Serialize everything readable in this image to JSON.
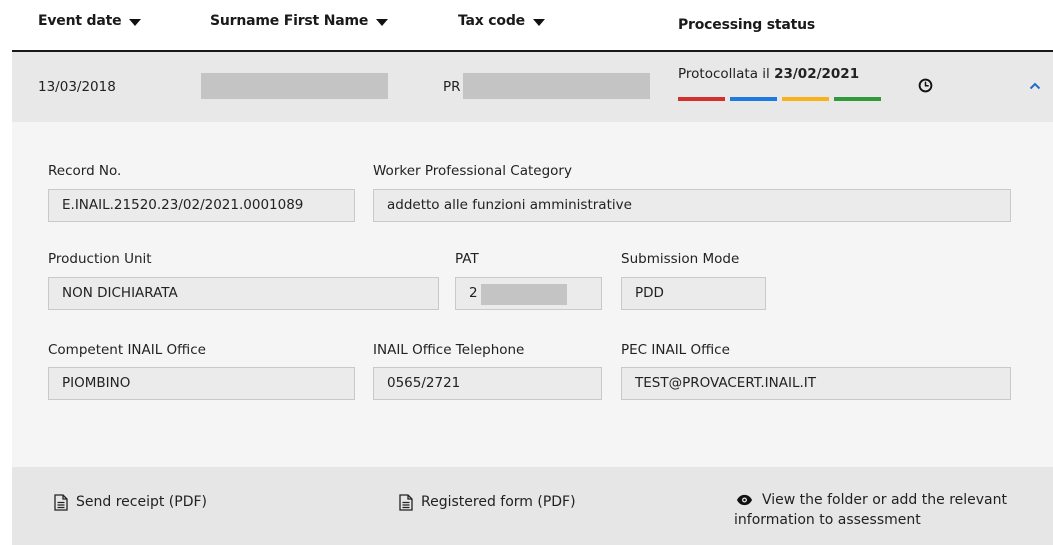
{
  "header": {
    "event_date": "Event date",
    "name": "Surname First Name",
    "tax_code": "Tax code",
    "status": "Processing status"
  },
  "row": {
    "event_date": "13/03/2018",
    "tax_code_prefix": "PR",
    "status_prefix": "Protocollata il ",
    "status_date": "23/02/2021",
    "status_colors": [
      "#d32f2f",
      "#1e7ae0",
      "#f9b21b",
      "#2e9a3b"
    ]
  },
  "detail": {
    "record_no": {
      "label": "Record No.",
      "value": "E.INAIL.21520.23/02/2021.0001089"
    },
    "worker_category": {
      "label": "Worker Professional Category",
      "value": "addetto alle funzioni amministrative"
    },
    "production_unit": {
      "label": "Production Unit",
      "value": "NON DICHIARATA"
    },
    "pat": {
      "label": "PAT",
      "value": "2"
    },
    "submission_mode": {
      "label": "Submission Mode",
      "value": "PDD"
    },
    "office": {
      "label": "Competent INAIL Office",
      "value": "PIOMBINO"
    },
    "telephone": {
      "label": "INAIL Office Telephone",
      "value": "0565/2721"
    },
    "pec": {
      "label": "PEC INAIL Office",
      "value": "TEST@PROVACERT.INAIL.IT"
    }
  },
  "footer": {
    "send_receipt": "Send receipt (PDF)",
    "registered_form": "Registered form (PDF)",
    "view_folder_line1": "View the folder or add the relevant",
    "view_folder_line2": "information to assessment"
  }
}
